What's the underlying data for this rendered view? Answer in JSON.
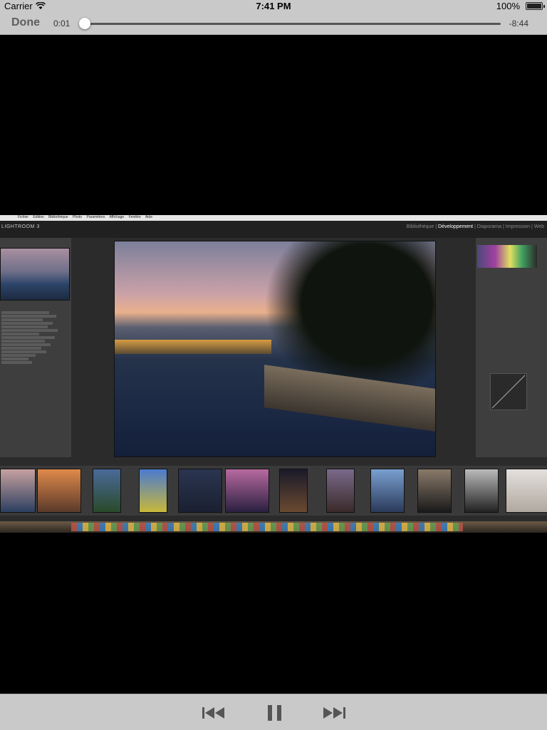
{
  "status_bar": {
    "carrier": "Carrier",
    "time": "7:41 PM",
    "battery": "100%"
  },
  "player": {
    "done_label": "Done",
    "current_time": "0:01",
    "remaining_time": "-8:44",
    "progress": 0.002
  },
  "video": {
    "mac_menu": [
      "Fichier",
      "Édition",
      "Bibliothèque",
      "Photo",
      "Paramètres",
      "Affichage",
      "Fenêtre",
      "Aide"
    ],
    "app_title": "LIGHTROOM 3",
    "modules": [
      "Bibliothèque",
      "Développement",
      "Diaporama",
      "Impression",
      "Web"
    ],
    "active_module": "Développement"
  },
  "icons": [
    "wifi-icon",
    "battery-icon",
    "previous-track-icon",
    "pause-icon",
    "next-track-icon"
  ]
}
